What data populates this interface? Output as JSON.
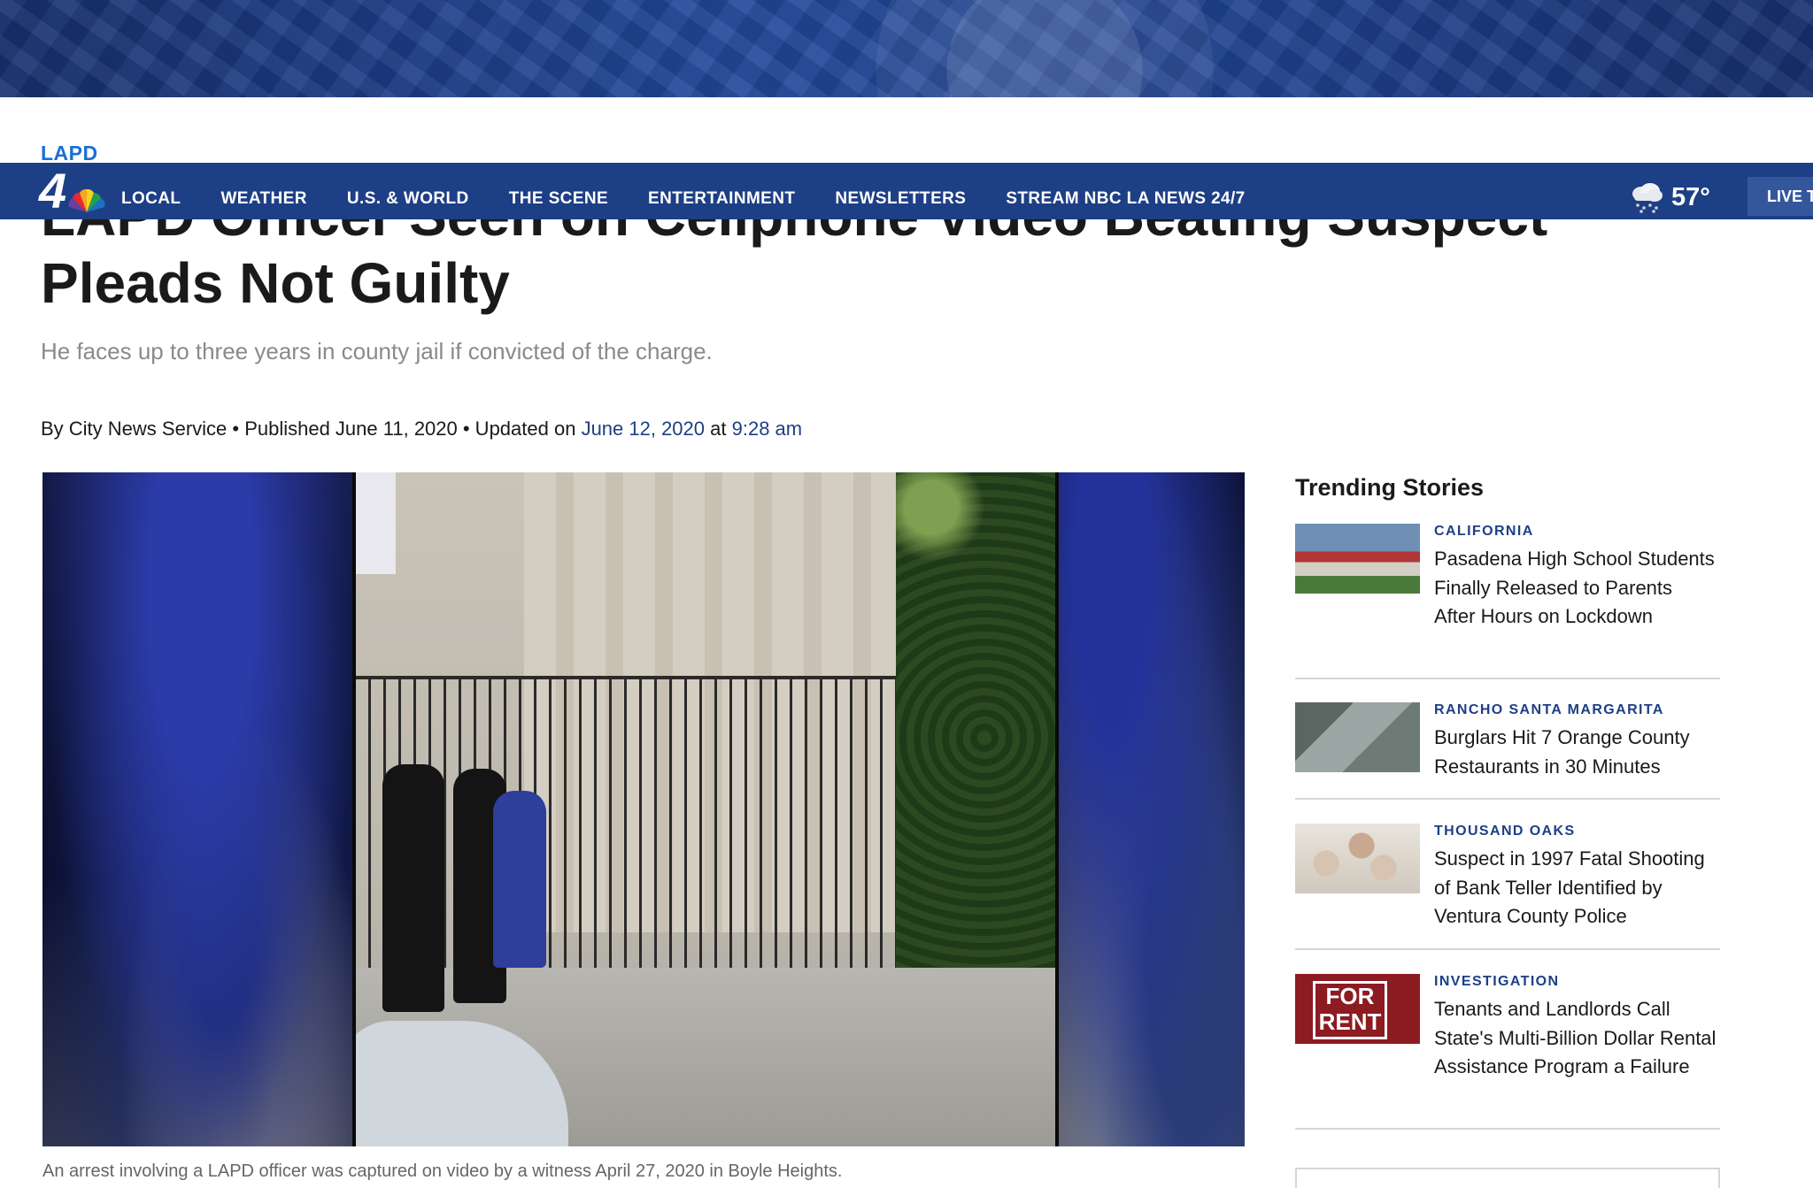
{
  "section": "LAPD",
  "nav": {
    "items": [
      "LOCAL",
      "WEATHER",
      "U.S. & WORLD",
      "THE SCENE",
      "ENTERTAINMENT",
      "NEWSLETTERS",
      "STREAM NBC LA NEWS 24/7"
    ],
    "weather_temp": "57°",
    "live_label": "LIVE TV"
  },
  "article": {
    "title": "LAPD Officer Seen on Cellphone Video Beating Suspect Pleads Not Guilty",
    "subtitle": "He faces up to three years in county jail if convicted of the charge.",
    "byline": {
      "prefix": "By City News Service • Published June 11, 2020 • Updated on ",
      "updated_date": "June 12, 2020",
      "at": " at ",
      "updated_time": "9:28 am"
    },
    "caption": "An arrest involving a LAPD officer was captured on video by a witness April 27, 2020 in Boyle Heights."
  },
  "trending": {
    "title": "Trending Stories",
    "items": [
      {
        "category": "CALIFORNIA",
        "headline": "Pasadena High School Students Finally Released to Parents After Hours on Lockdown"
      },
      {
        "category": "RANCHO SANTA MARGARITA",
        "headline": "Burglars Hit 7 Orange County Restaurants in 30 Minutes"
      },
      {
        "category": "THOUSAND OAKS",
        "headline": "Suspect in 1997 Fatal Shooting of Bank Teller Identified by Ventura County Police"
      },
      {
        "category": "INVESTIGATION",
        "headline": "Tenants and Landlords Call State's Multi-Billion Dollar Rental Assistance Program a Failure",
        "thumb_text": "FOR RENT"
      }
    ]
  },
  "colors": {
    "nav_bg": "#1d3f86",
    "accent_blue": "#1b6fd6",
    "category_blue": "#1d3f86"
  }
}
